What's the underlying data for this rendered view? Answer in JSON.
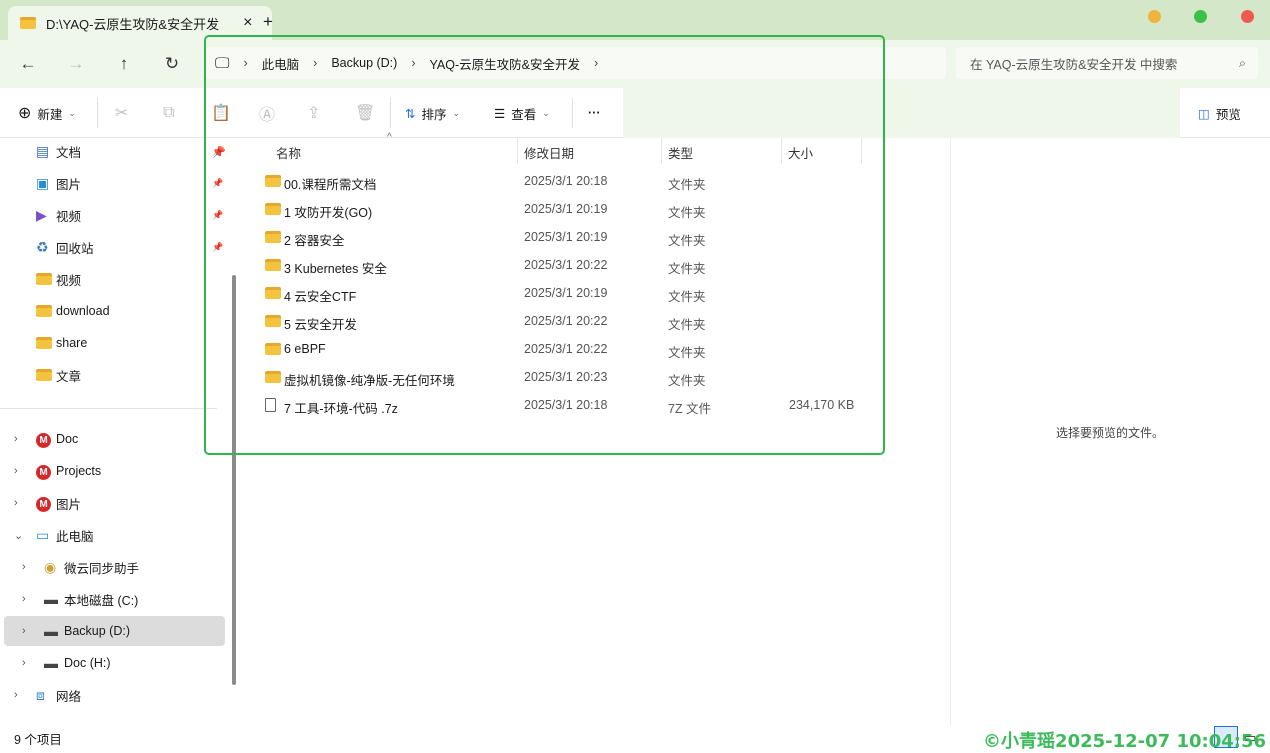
{
  "window": {
    "tab_title": "D:\\YAQ-云原生攻防&安全开发",
    "new_tab": "+",
    "close": "×"
  },
  "address": {
    "segments": [
      "此电脑",
      "Backup (D:)",
      "YAQ-云原生攻防&安全开发"
    ],
    "search_placeholder": "在 YAQ-云原生攻防&安全开发 中搜索"
  },
  "toolbar": {
    "new": "新建",
    "sort": "排序",
    "view": "查看",
    "more": "···",
    "preview": "预览"
  },
  "sidebar": {
    "pinned": [
      {
        "label": "文档",
        "icon": "documents-icon"
      },
      {
        "label": "图片",
        "icon": "pictures-icon"
      },
      {
        "label": "视频",
        "icon": "videos-icon"
      },
      {
        "label": "回收站",
        "icon": "recycle-bin-icon"
      },
      {
        "label": "视频",
        "icon": "folder-icon"
      },
      {
        "label": "download",
        "icon": "folder-icon"
      },
      {
        "label": "share",
        "icon": "folder-icon"
      },
      {
        "label": "文章",
        "icon": "folder-icon"
      }
    ],
    "tree": [
      {
        "label": "Doc",
        "icon": "cloud-drive-icon"
      },
      {
        "label": "Projects",
        "icon": "cloud-drive-icon"
      },
      {
        "label": "图片",
        "icon": "cloud-drive-icon"
      },
      {
        "label": "此电脑",
        "icon": "computer-icon"
      },
      {
        "label": "微云同步助手",
        "icon": "sync-icon"
      },
      {
        "label": "本地磁盘 (C:)",
        "icon": "drive-icon"
      },
      {
        "label": "Backup (D:)",
        "icon": "drive-icon",
        "selected": true
      },
      {
        "label": "Doc (H:)",
        "icon": "drive-icon"
      },
      {
        "label": "网络",
        "icon": "network-icon"
      }
    ]
  },
  "list": {
    "columns": [
      "名称",
      "修改日期",
      "类型",
      "大小"
    ],
    "rows": [
      {
        "name": "00.课程所需文档",
        "date": "2025/3/1 20:18",
        "type": "文件夹",
        "size": ""
      },
      {
        "name": "1 攻防开发(GO)",
        "date": "2025/3/1 20:19",
        "type": "文件夹",
        "size": ""
      },
      {
        "name": "2 容器安全",
        "date": "2025/3/1 20:19",
        "type": "文件夹",
        "size": ""
      },
      {
        "name": "3 Kubernetes 安全",
        "date": "2025/3/1 20:22",
        "type": "文件夹",
        "size": ""
      },
      {
        "name": "4 云安全CTF",
        "date": "2025/3/1 20:19",
        "type": "文件夹",
        "size": ""
      },
      {
        "name": "5 云安全开发",
        "date": "2025/3/1 20:22",
        "type": "文件夹",
        "size": ""
      },
      {
        "name": "6 eBPF",
        "date": "2025/3/1 20:22",
        "type": "文件夹",
        "size": ""
      },
      {
        "name": "虚拟机镜像-纯净版-无任何环境",
        "date": "2025/3/1 20:23",
        "type": "文件夹",
        "size": ""
      },
      {
        "name": "7 工具-环境-代码 .7z",
        "date": "2025/3/1 20:18",
        "type": "7Z 文件",
        "size": "234,170 KB"
      }
    ]
  },
  "preview": {
    "message": "选择要预览的文件。"
  },
  "status": {
    "count": "9 个项目"
  },
  "watermark": "©小青瑶2025-12-07 10:04:56",
  "colors": {
    "highlight_frame": "#2fb54f",
    "titlebar": "#d4e8c9"
  }
}
